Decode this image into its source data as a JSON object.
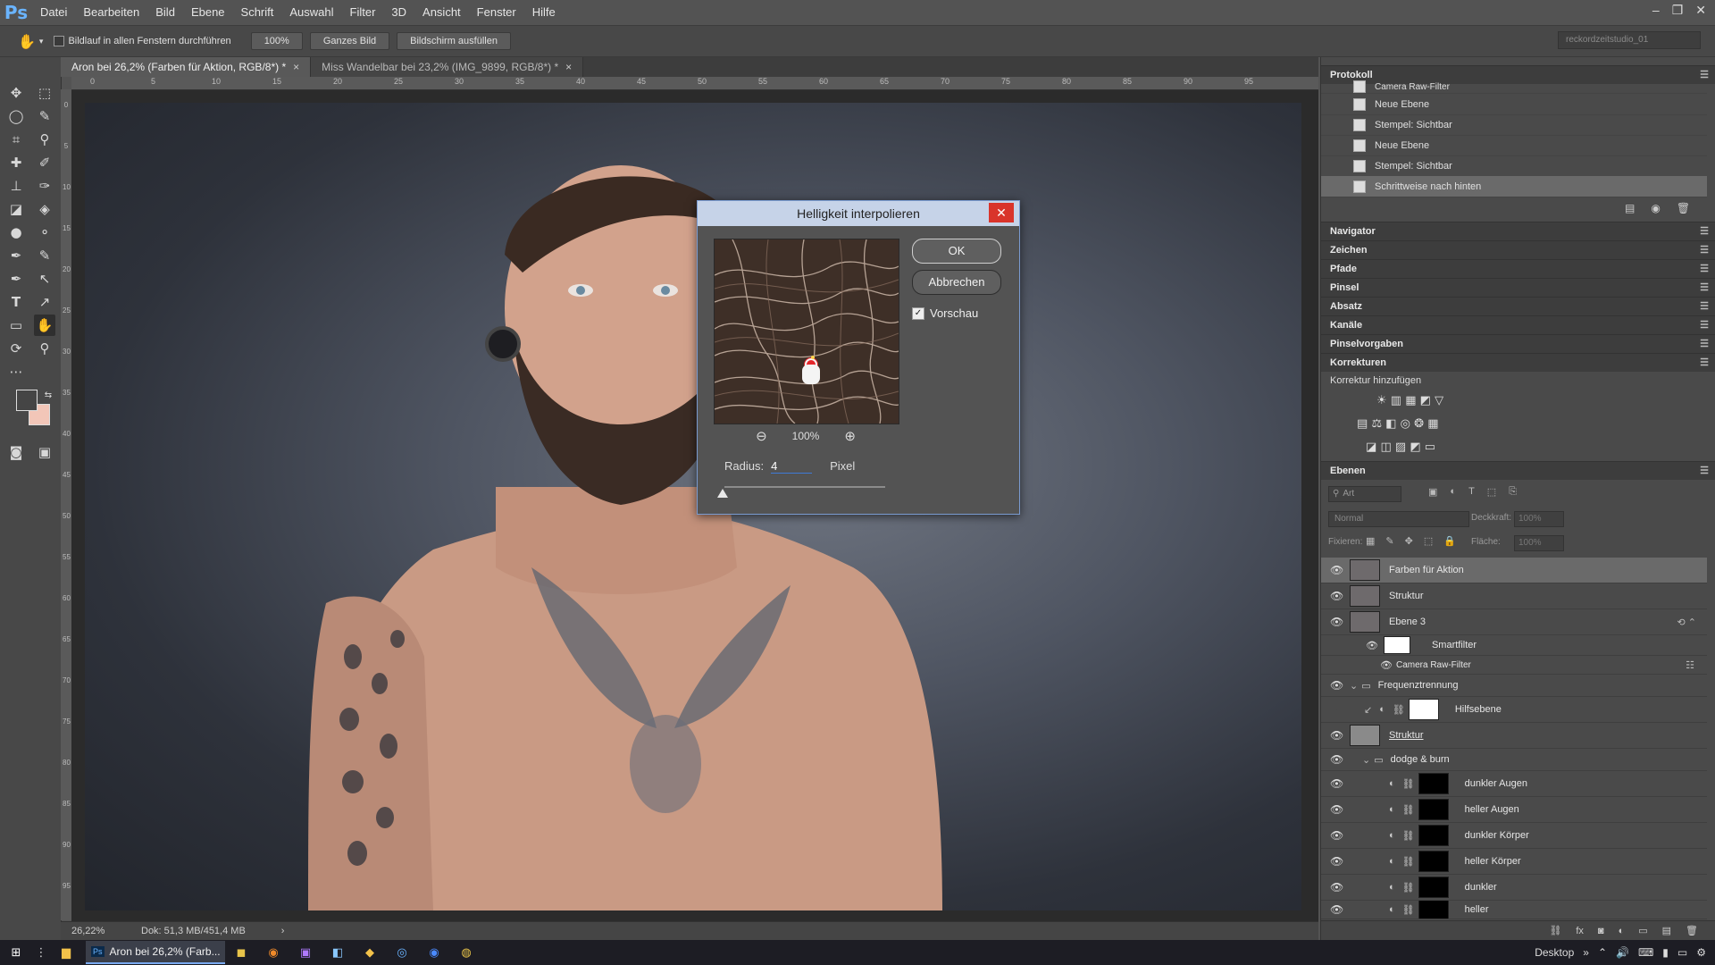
{
  "app": {
    "logo": "Ps",
    "menu": [
      "Datei",
      "Bearbeiten",
      "Bild",
      "Ebene",
      "Schrift",
      "Auswahl",
      "Filter",
      "3D",
      "Ansicht",
      "Fenster",
      "Hilfe"
    ],
    "window_controls": [
      "–",
      "❐",
      "✕"
    ]
  },
  "options": {
    "hand_icon": "hand-icon",
    "scroll_all_label": "Bildlauf in allen Fenstern durchführen",
    "zoom_btn": "100%",
    "fit_btn": "Ganzes Bild",
    "fill_btn": "Bildschirm ausfüllen",
    "workspace": "reckordzeitstudio_01"
  },
  "tabs": [
    {
      "label": "Aron bei 26,2% (Farben für Aktion, RGB/8*) *",
      "close": "×"
    },
    {
      "label": "Miss Wandelbar bei 23,2% (IMG_9899, RGB/8*) *",
      "close": "×"
    }
  ],
  "ruler": {
    "top": [
      "0",
      "5",
      "10",
      "15",
      "20",
      "25",
      "30",
      "35",
      "40",
      "45",
      "50",
      "55",
      "60",
      "65",
      "70",
      "75",
      "80",
      "85",
      "90",
      "95"
    ],
    "left": [
      "0",
      "5",
      "10",
      "15",
      "20",
      "25",
      "30",
      "35",
      "40",
      "45",
      "50",
      "55",
      "60",
      "65",
      "70",
      "75",
      "80",
      "85",
      "90",
      "95"
    ]
  },
  "status": {
    "zoom": "26,22%",
    "doc": "Dok: 51,3 MB/451,4 MB",
    "arrow": "›"
  },
  "dialog": {
    "title": "Helligkeit interpolieren",
    "close": "✕",
    "ok": "OK",
    "cancel": "Abbrechen",
    "preview_label": "Vorschau",
    "preview_checked": "✓",
    "zoom": "100%",
    "zoom_out": "⊖",
    "zoom_in": "⊕",
    "radius_label": "Radius:",
    "radius_value": "4",
    "unit": "Pixel"
  },
  "history": {
    "title": "Protokoll",
    "rows": [
      {
        "label": "Camera Raw-Filter"
      },
      {
        "label": "Neue Ebene"
      },
      {
        "label": "Stempel: Sichtbar"
      },
      {
        "label": "Neue Ebene"
      },
      {
        "label": "Stempel: Sichtbar"
      },
      {
        "label": "Schrittweise nach hinten"
      }
    ]
  },
  "panels": [
    "Navigator",
    "Zeichen",
    "Pfade",
    "Pinsel",
    "Absatz",
    "Kanäle",
    "Pinselvorgaben",
    "Korrekturen"
  ],
  "adjustments": {
    "title": "Korrektur hinzufügen"
  },
  "layers": {
    "title": "Ebenen",
    "filter": "Art",
    "blend": "Normal",
    "opacity_label": "Deckkraft:",
    "opacity": "100%",
    "lock_label": "Fixieren:",
    "fill_label": "Fläche:",
    "fill": "100%",
    "rows": [
      {
        "label": "Farben für Aktion"
      },
      {
        "label": "Struktur"
      },
      {
        "label": "Ebene 3"
      },
      {
        "label": "Smartfilter"
      },
      {
        "label": "Camera Raw-Filter"
      },
      {
        "label": "Frequenztrennung"
      },
      {
        "label": "Hilfsebene"
      },
      {
        "label": "Struktur"
      },
      {
        "label": "dodge & burn"
      },
      {
        "label": "dunkler Augen"
      },
      {
        "label": "heller Augen"
      },
      {
        "label": "dunkler Körper"
      },
      {
        "label": "heller Körper"
      },
      {
        "label": "dunkler"
      },
      {
        "label": "heller"
      }
    ]
  },
  "taskbar": {
    "active": "Aron bei 26,2% (Farb...",
    "desktop": "Desktop",
    "chevron": "»"
  }
}
